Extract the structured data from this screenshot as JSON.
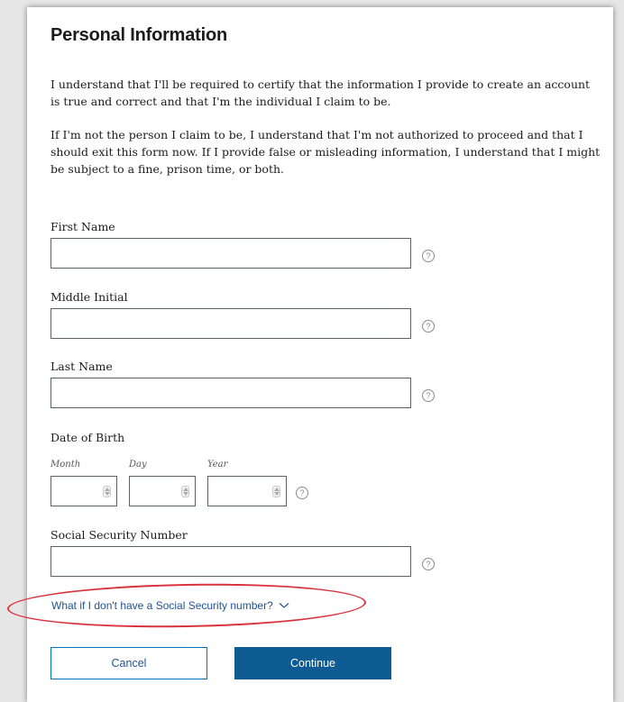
{
  "form": {
    "title": "Personal Information",
    "para1": "I understand that I'll be required to certify that the information I provide to create an account is true and correct and that I'm the individual I claim to be.",
    "para2": "If I'm not the person I claim to be, I understand that I'm not authorized to proceed and that I should exit this form now. If I provide false or misleading information, I understand that I might be subject to a fine, prison time, or both.",
    "first_name": {
      "label": "First Name",
      "value": ""
    },
    "middle_initial": {
      "label": "Middle Initial",
      "value": ""
    },
    "last_name": {
      "label": "Last Name",
      "value": ""
    },
    "dob": {
      "label": "Date of Birth",
      "month_label": "Month",
      "day_label": "Day",
      "year_label": "Year"
    },
    "ssn": {
      "label": "Social Security Number",
      "value": ""
    },
    "help_glyph": "?",
    "no_ssn_link": "What if I don't have a Social Security number?",
    "cancel_label": "Cancel",
    "continue_label": "Continue"
  },
  "colors": {
    "link": "#205493",
    "primary_button": "#0f5c94",
    "annotation_circle": "#d9343d"
  },
  "icons": {
    "help": "help-circle-icon",
    "chevron": "chevron-down-icon"
  }
}
